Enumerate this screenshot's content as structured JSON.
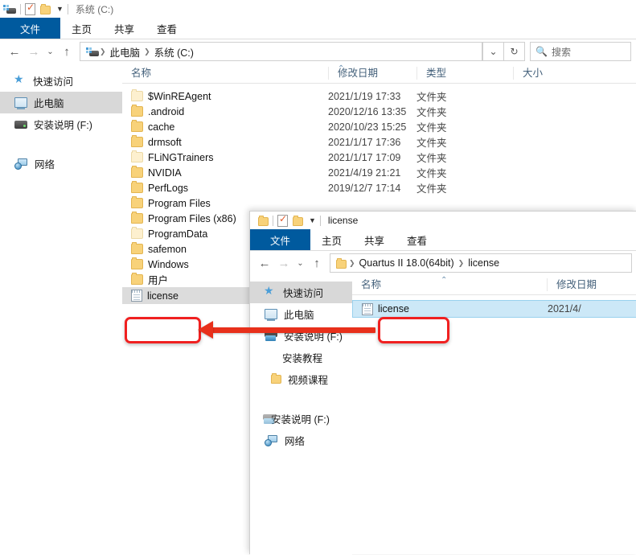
{
  "window1": {
    "title": "系统 (C:)",
    "qat": {
      "drive_icon": "drive-icon",
      "properties_icon": "properties-checkbox-icon",
      "newfolder_icon": "new-folder-icon",
      "more_icon": "chevron-down-icon"
    },
    "ribbon_tabs": [
      {
        "label": "文件",
        "selected": true
      },
      {
        "label": "主页",
        "selected": false
      },
      {
        "label": "共享",
        "selected": false
      },
      {
        "label": "查看",
        "selected": false
      }
    ],
    "address": {
      "back_icon": "back-arrow-icon",
      "forward_icon": "forward-arrow-icon",
      "recent_icon": "recent-locations-chevron-icon",
      "up_icon": "up-arrow-icon",
      "refresh_icon": "refresh-icon",
      "dropdown_icon": "chevron-down-icon",
      "crumbs": [
        "此电脑",
        "系统 (C:)"
      ]
    },
    "search": {
      "icon": "search-icon",
      "placeholder": "搜索"
    },
    "nav": [
      {
        "label": "快速访问",
        "icon": "star-icon",
        "selected": false
      },
      {
        "label": "此电脑",
        "icon": "this-pc-icon",
        "selected": true
      },
      {
        "label": "安装说明 (F:)",
        "icon": "drive-icon",
        "selected": false
      },
      {
        "label": "网络",
        "icon": "network-icon",
        "selected": false
      }
    ],
    "columns": [
      "名称",
      "修改日期",
      "类型",
      "大小"
    ],
    "files": [
      {
        "name": "$WinREAgent",
        "date": "2021/1/19 17:33",
        "type": "文件夹",
        "icon": "folder-icon-pale"
      },
      {
        "name": ".android",
        "date": "2020/12/16 13:35",
        "type": "文件夹",
        "icon": "folder-icon"
      },
      {
        "name": "cache",
        "date": "2020/10/23 15:25",
        "type": "文件夹",
        "icon": "folder-icon"
      },
      {
        "name": "drmsoft",
        "date": "2021/1/17 17:36",
        "type": "文件夹",
        "icon": "folder-icon"
      },
      {
        "name": "FLiNGTrainers",
        "date": "2021/1/17 17:09",
        "type": "文件夹",
        "icon": "folder-icon"
      },
      {
        "name": "NVIDIA",
        "date": "2021/4/19 21:21",
        "type": "文件夹",
        "icon": "folder-icon"
      },
      {
        "name": "PerfLogs",
        "date": "2019/12/7 17:14",
        "type": "文件夹",
        "icon": "folder-icon"
      },
      {
        "name": "Program Files",
        "date": "",
        "type": "",
        "icon": "folder-icon"
      },
      {
        "name": "Program Files (x86)",
        "date": "",
        "type": "",
        "icon": "folder-icon"
      },
      {
        "name": "ProgramData",
        "date": "",
        "type": "",
        "icon": "folder-icon-pale"
      },
      {
        "name": "safemon",
        "date": "",
        "type": "",
        "icon": "folder-icon"
      },
      {
        "name": "Windows",
        "date": "",
        "type": "",
        "icon": "folder-icon"
      },
      {
        "name": "用户",
        "date": "",
        "type": "",
        "icon": "folder-icon"
      },
      {
        "name": "license",
        "date": "",
        "type": "",
        "icon": "text-file-icon",
        "selected": true
      }
    ]
  },
  "window2": {
    "title": "license",
    "qat": {
      "folder_icon": "folder-icon",
      "properties_icon": "properties-checkbox-icon",
      "newfolder_icon": "new-folder-icon",
      "more_icon": "chevron-down-icon"
    },
    "ribbon_tabs": [
      {
        "label": "文件",
        "selected": true
      },
      {
        "label": "主页",
        "selected": false
      },
      {
        "label": "共享",
        "selected": false
      },
      {
        "label": "查看",
        "selected": false
      }
    ],
    "address": {
      "crumbs": [
        "Quartus II 18.0(64bit)",
        "license"
      ]
    },
    "nav": [
      {
        "label": "快速访问",
        "icon": "star-icon",
        "selected": true
      },
      {
        "label": "此电脑",
        "icon": "this-pc-icon",
        "selected": false
      },
      {
        "label": "安装说明 (F:)",
        "icon": "drive-icon-blue",
        "selected": false
      },
      {
        "label": "安装教程",
        "icon": "",
        "selected": false
      },
      {
        "label": "视频课程",
        "icon": "folder-icon",
        "selected": false
      },
      {
        "label": "安装说明 (F:)",
        "icon": "drive-icon-blue",
        "selected": false
      },
      {
        "label": "网络",
        "icon": "network-icon",
        "selected": false
      }
    ],
    "columns": [
      "名称",
      "修改日期"
    ],
    "files": [
      {
        "name": "license",
        "date": "2021/4/",
        "icon": "text-file-icon",
        "selected": true
      }
    ]
  },
  "annotation": {
    "highlight_source": "license-file-in-license-folder",
    "highlight_target": "license-file-in-c-drive",
    "arrow_direction": "right-to-left",
    "color": "#e8301b"
  }
}
